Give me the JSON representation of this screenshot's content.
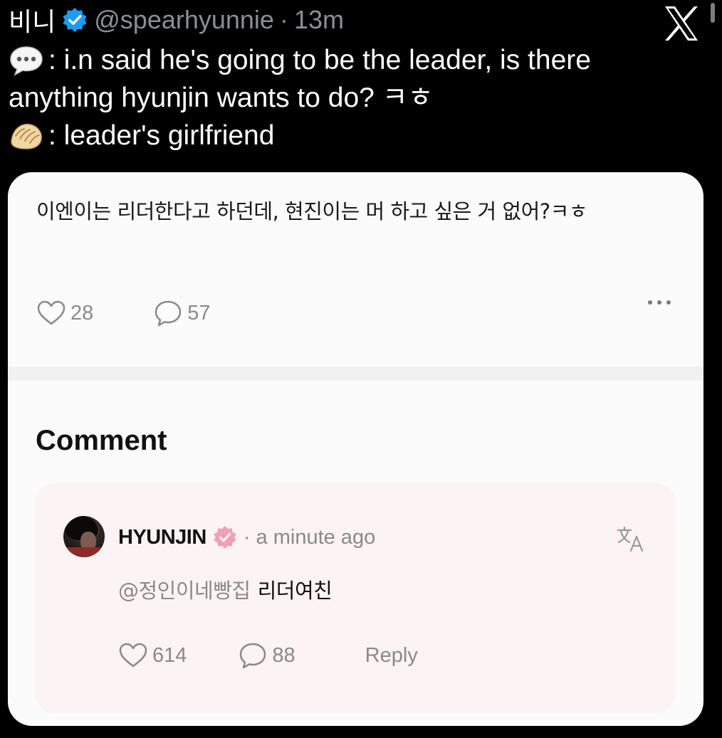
{
  "tweet": {
    "display_name": "비니",
    "handle": "@spearhyunnie",
    "separator": "·",
    "time": "13m",
    "lines": [
      {
        "icon": "speech-bubble-icon",
        "text": ": i.n said he's going to be the leader, is there"
      },
      {
        "icon": "",
        "text": "anything hyunjin wants to do? ㅋㅎ"
      },
      {
        "icon": "dumpling-icon",
        "text": ": leader's girlfriend"
      }
    ]
  },
  "post": {
    "text": "이엔이는 리더한다고 하던데, 현진이는 머 하고 싶은 거 없어?ㅋㅎ",
    "likes": "28",
    "comments": "57"
  },
  "comments_section": {
    "title": "Comment",
    "comment": {
      "author": "HYUNJIN",
      "time": "· a minute ago",
      "mention": "@정인이네빵집",
      "text": "리더여친",
      "likes": "614",
      "replies": "88",
      "reply_label": "Reply"
    }
  },
  "colors": {
    "background": "#000000",
    "verified_blue": "#1d9bf0",
    "card_bg": "#fcfbfb",
    "comment_bg": "#fcf3f4",
    "badge_pink": "#f2a0b6",
    "muted": "#8a8a8a"
  }
}
